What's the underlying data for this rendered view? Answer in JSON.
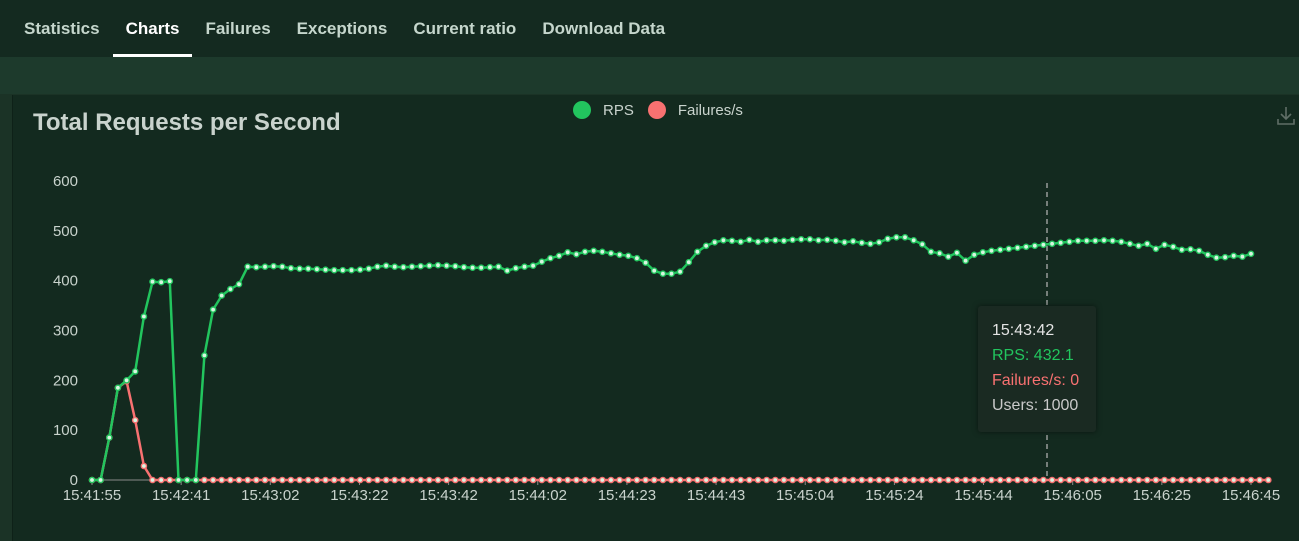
{
  "tabs": [
    {
      "label": "Statistics"
    },
    {
      "label": "Charts",
      "active": true
    },
    {
      "label": "Failures"
    },
    {
      "label": "Exceptions"
    },
    {
      "label": "Current ratio"
    },
    {
      "label": "Download Data"
    }
  ],
  "colors": {
    "rps": "#22c55e",
    "failures": "#f87171",
    "axis_text": "#c9d3cd"
  },
  "tooltip": {
    "time": "15:43:42",
    "rps": "RPS: 432.1",
    "failures": "Failures/s: 0",
    "users": "Users: 1000"
  },
  "chart_data": {
    "type": "line",
    "title": "Total Requests per Second",
    "ylim": [
      0,
      600
    ],
    "y_ticks": [
      0,
      100,
      200,
      300,
      400,
      500,
      600
    ],
    "x_tick_labels": [
      "15:41:55",
      "15:42:41",
      "15:43:02",
      "15:43:22",
      "15:43:42",
      "15:44:02",
      "15:44:23",
      "15:44:43",
      "15:45:04",
      "15:45:24",
      "15:45:44",
      "15:46:05",
      "15:46:25",
      "15:46:45"
    ],
    "legend": "top-center",
    "grid": false,
    "series": [
      {
        "name": "RPS",
        "color": "#22c55e",
        "values": [
          0,
          0,
          85,
          185,
          200,
          218,
          328,
          398,
          397,
          399,
          0,
          0,
          0,
          250,
          342,
          370,
          383,
          393,
          428,
          427,
          428,
          429,
          428,
          425,
          424,
          424,
          423,
          422,
          421,
          421,
          421,
          422,
          424,
          428,
          430,
          428,
          427,
          428,
          429,
          430,
          431,
          430,
          429,
          427,
          426,
          426,
          427,
          428,
          420,
          425,
          428,
          430,
          438,
          445,
          450,
          457,
          453,
          458,
          460,
          458,
          455,
          452,
          450,
          445,
          436,
          420,
          414,
          414,
          418,
          437,
          458,
          470,
          477,
          481,
          480,
          478,
          482,
          478,
          481,
          481,
          480,
          482,
          483,
          483,
          481,
          482,
          480,
          477,
          479,
          476,
          474,
          477,
          484,
          487,
          487,
          481,
          473,
          458,
          455,
          448,
          456,
          440,
          452,
          457,
          460,
          462,
          464,
          466,
          468,
          470,
          472,
          474,
          476,
          478,
          480,
          480,
          480,
          481,
          480,
          478,
          474,
          470,
          474,
          464,
          472,
          468,
          462,
          463,
          460,
          452,
          446,
          447,
          450,
          448,
          454
        ]
      },
      {
        "name": "Failures/s",
        "color": "#f87171",
        "values": [
          0,
          0,
          85,
          185,
          198,
          120,
          28,
          0,
          0,
          0,
          0,
          0,
          0,
          0,
          0,
          0,
          0,
          0,
          0,
          0,
          0,
          0,
          0,
          0,
          0,
          0,
          0,
          0,
          0,
          0,
          0,
          0,
          0,
          0,
          0,
          0,
          0,
          0,
          0,
          0,
          0,
          0,
          0,
          0,
          0,
          0,
          0,
          0,
          0,
          0,
          0,
          0,
          0,
          0,
          0,
          0,
          0,
          0,
          0,
          0,
          0,
          0,
          0,
          0,
          0,
          0,
          0,
          0,
          0,
          0,
          0,
          0,
          0,
          0,
          0,
          0,
          0,
          0,
          0,
          0,
          0,
          0,
          0,
          0,
          0,
          0,
          0,
          0,
          0,
          0,
          0,
          0,
          0,
          0,
          0,
          0,
          0,
          0,
          0,
          0,
          0,
          0,
          0,
          0,
          0,
          0,
          0,
          0,
          0,
          0,
          0,
          0,
          0,
          0,
          0,
          0,
          0,
          0,
          0,
          0,
          0,
          0,
          0,
          0,
          0,
          0,
          0,
          0,
          0,
          0,
          0,
          0,
          0,
          0,
          0,
          0,
          0
        ]
      }
    ]
  }
}
